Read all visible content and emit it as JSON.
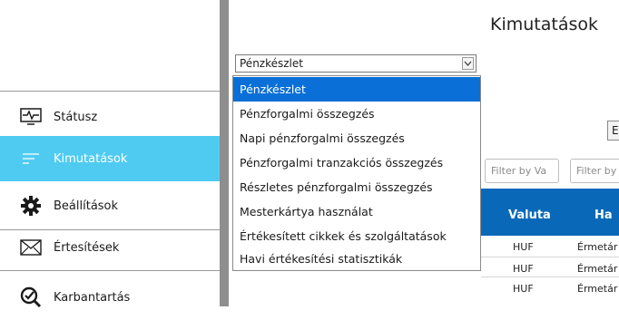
{
  "sidebar": {
    "items": [
      {
        "label": "Státusz",
        "icon": "status-monitor-icon"
      },
      {
        "label": "Kimutatások",
        "icon": "report-lines-icon",
        "active": true
      },
      {
        "label": "Beállítások",
        "icon": "gear-icon"
      },
      {
        "label": "Értesítések",
        "icon": "envelope-icon"
      },
      {
        "label": "Karbantartás",
        "icon": "maintenance-check-icon"
      }
    ]
  },
  "header": {
    "title": "Kimutatások"
  },
  "report_select": {
    "value": "Pénzkészlet",
    "options": [
      "Pénzkészlet",
      "Pénzforgalmi összegzés",
      "Napi pénzforgalmi összegzés",
      "Pénzforgalmi tranzakciós összegzés",
      "Részletes pénzforgalmi összegzés",
      "Mesterkártya használat",
      "Értékesített cikkek és szolgáltatások",
      "Havi értékesítési statisztikák"
    ]
  },
  "toolbar": {
    "export_label": "Ex"
  },
  "filters": {
    "valuta_placeholder": "Filter by Va",
    "second_placeholder": "Filter by"
  },
  "table": {
    "headers": [
      "Valuta",
      "Ha"
    ],
    "rows": [
      [
        "HUF",
        "Érmetár"
      ],
      [
        "HUF",
        "Érmetár"
      ],
      [
        "HUF",
        "Érmetár"
      ]
    ]
  },
  "colors": {
    "accent": "#4fcbf2",
    "selection": "#0a6fd6",
    "table_header": "#0969b8"
  }
}
